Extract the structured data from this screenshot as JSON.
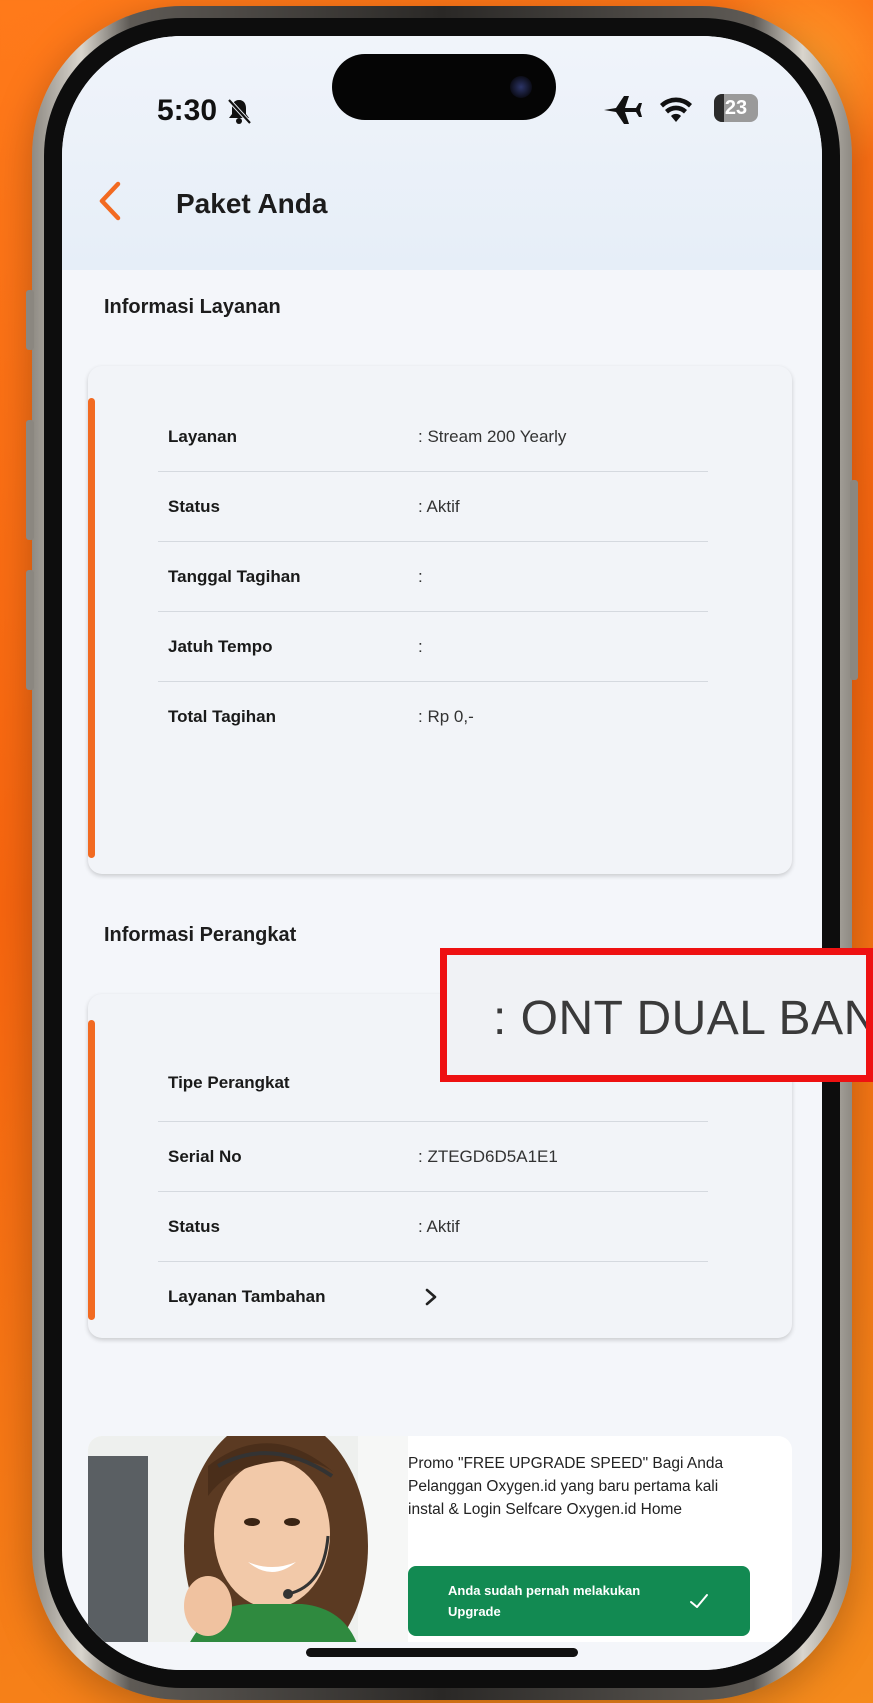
{
  "status_bar": {
    "time": "5:30",
    "battery": "23"
  },
  "colors": {
    "accent": "#f26a21",
    "button_green": "#128a52",
    "highlight_red": "#ee1111"
  },
  "header": {
    "back_icon": "chevron-left-icon",
    "title": "Paket Anda"
  },
  "service_info": {
    "title": "Informasi Layanan",
    "rows": [
      {
        "label": "Layanan",
        "value": ": Stream 200 Yearly"
      },
      {
        "label": "Status",
        "value": ": Aktif"
      },
      {
        "label": "Tanggal Tagihan",
        "value": ":"
      },
      {
        "label": "Jatuh Tempo",
        "value": ":"
      },
      {
        "label": "Total Tagihan",
        "value": ": Rp 0,-"
      }
    ]
  },
  "device_info": {
    "title": "Informasi Perangkat",
    "rows": [
      {
        "label": "Tipe Perangkat",
        "value": ""
      },
      {
        "label": "Serial No",
        "value": ": ZTEGD6D5A1E1"
      },
      {
        "label": "Status",
        "value": ": Aktif"
      },
      {
        "label": "Layanan Tambahan",
        "value": "",
        "icon": "chevron-right-icon"
      }
    ]
  },
  "zoom_callout": {
    "text": ": ONT DUAL BAND"
  },
  "promo": {
    "text": "Promo \"FREE UPGRADE SPEED\" Bagi Anda Pelanggan Oxygen.id yang baru pertama kali instal & Login Selfcare Oxygen.id Home",
    "button_label": "Anda sudah pernah melakukan Upgrade",
    "button_icon": "check-icon"
  }
}
